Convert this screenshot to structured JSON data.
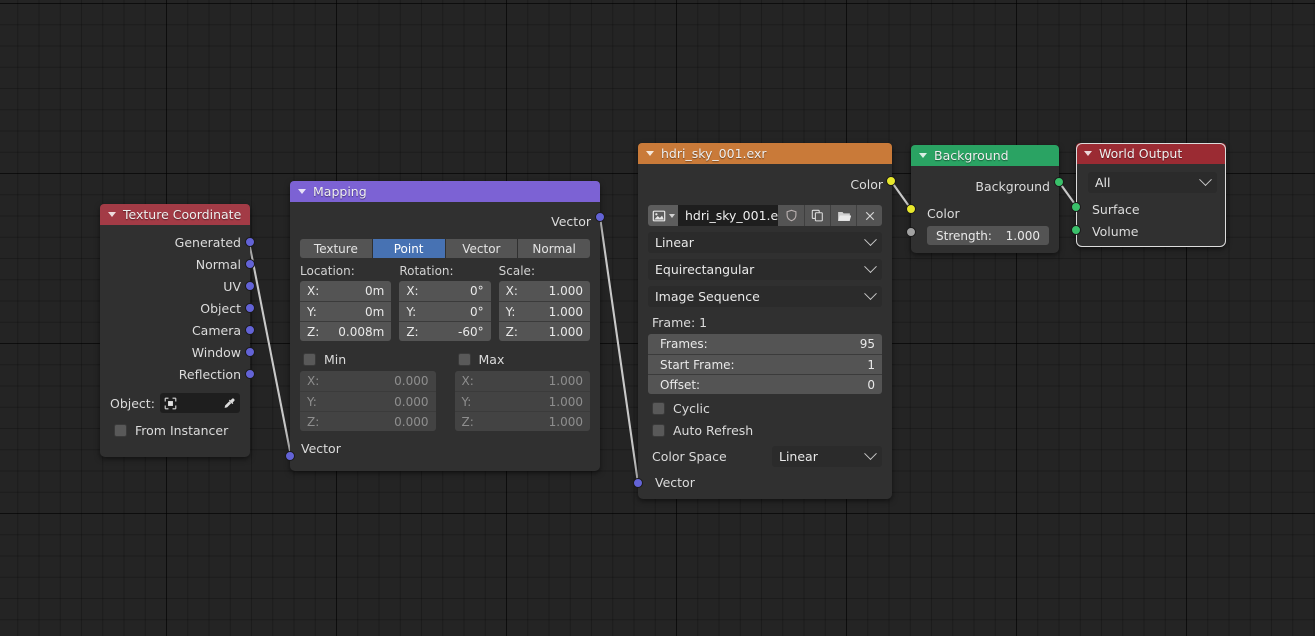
{
  "app": {
    "editor": "blender-shader-node-editor"
  },
  "nodes": {
    "texture_coordinate": {
      "title": "Texture Coordinate",
      "header_color": "#a33b46",
      "outputs": [
        "Generated",
        "Normal",
        "UV",
        "Object",
        "Camera",
        "Window",
        "Reflection"
      ],
      "object_label": "Object:",
      "object_value": "",
      "from_instancer_label": "From Instancer",
      "from_instancer_checked": false
    },
    "mapping": {
      "title": "Mapping",
      "header_color": "#7c62d4",
      "output_label": "Vector",
      "input_label": "Vector",
      "tabs": [
        "Texture",
        "Point",
        "Vector",
        "Normal"
      ],
      "active_tab": "Point",
      "columns": [
        {
          "header": "Location:",
          "axes": [
            "X:",
            "Y:",
            "Z:"
          ],
          "values": [
            "0m",
            "0m",
            "0.008m"
          ]
        },
        {
          "header": "Rotation:",
          "axes": [
            "X:",
            "Y:",
            "Z:"
          ],
          "values": [
            "0°",
            "0°",
            "-60°"
          ]
        },
        {
          "header": "Scale:",
          "axes": [
            "X:",
            "Y:",
            "Z:"
          ],
          "values": [
            "1.000",
            "1.000",
            "1.000"
          ]
        }
      ],
      "min": {
        "label": "Min",
        "checked": false,
        "axes": [
          "X:",
          "Y:",
          "Z:"
        ],
        "values": [
          "0.000",
          "0.000",
          "0.000"
        ]
      },
      "max": {
        "label": "Max",
        "checked": false,
        "axes": [
          "X:",
          "Y:",
          "Z:"
        ],
        "values": [
          "1.000",
          "1.000",
          "1.000"
        ]
      }
    },
    "environment_texture": {
      "title": "hdri_sky_001.exr",
      "header_color": "#c97a39",
      "output_label": "Color",
      "image_name": "hdri_sky_001.exr",
      "interpolation": "Linear",
      "projection": "Equirectangular",
      "source": "Image Sequence",
      "frame_label": "Frame: 1",
      "frames_label": "Frames:",
      "frames_value": "95",
      "start_frame_label": "Start Frame:",
      "start_frame_value": "1",
      "offset_label": "Offset:",
      "offset_value": "0",
      "cyclic_label": "Cyclic",
      "cyclic_checked": false,
      "auto_refresh_label": "Auto Refresh",
      "auto_refresh_checked": false,
      "color_space_label": "Color Space",
      "color_space_value": "Linear",
      "input_label": "Vector"
    },
    "background": {
      "title": "Background",
      "header_color": "#2aa363",
      "output_label": "Background",
      "color_label": "Color",
      "strength_label": "Strength:",
      "strength_value": "1.000"
    },
    "world_output": {
      "title": "World Output",
      "header_color": "#9b2b33",
      "target": "All",
      "inputs": [
        "Surface",
        "Volume"
      ],
      "selected": true
    }
  },
  "socket_colors": {
    "vector": "#6363d6",
    "color": "#e8e82c",
    "shader": "#3ac06a",
    "float": "#a1a1a1"
  },
  "links": [
    {
      "from": "texture_coordinate.Generated",
      "to": "mapping.Vector",
      "color": "#c9c9c9"
    },
    {
      "from": "mapping.Vector",
      "to": "environment_texture.Vector",
      "color": "#c9c9c9"
    },
    {
      "from": "environment_texture.Color",
      "to": "background.Color",
      "color": "#c9c9c9"
    },
    {
      "from": "background.Background",
      "to": "world_output.Surface",
      "color": "#c9c9c9"
    }
  ]
}
